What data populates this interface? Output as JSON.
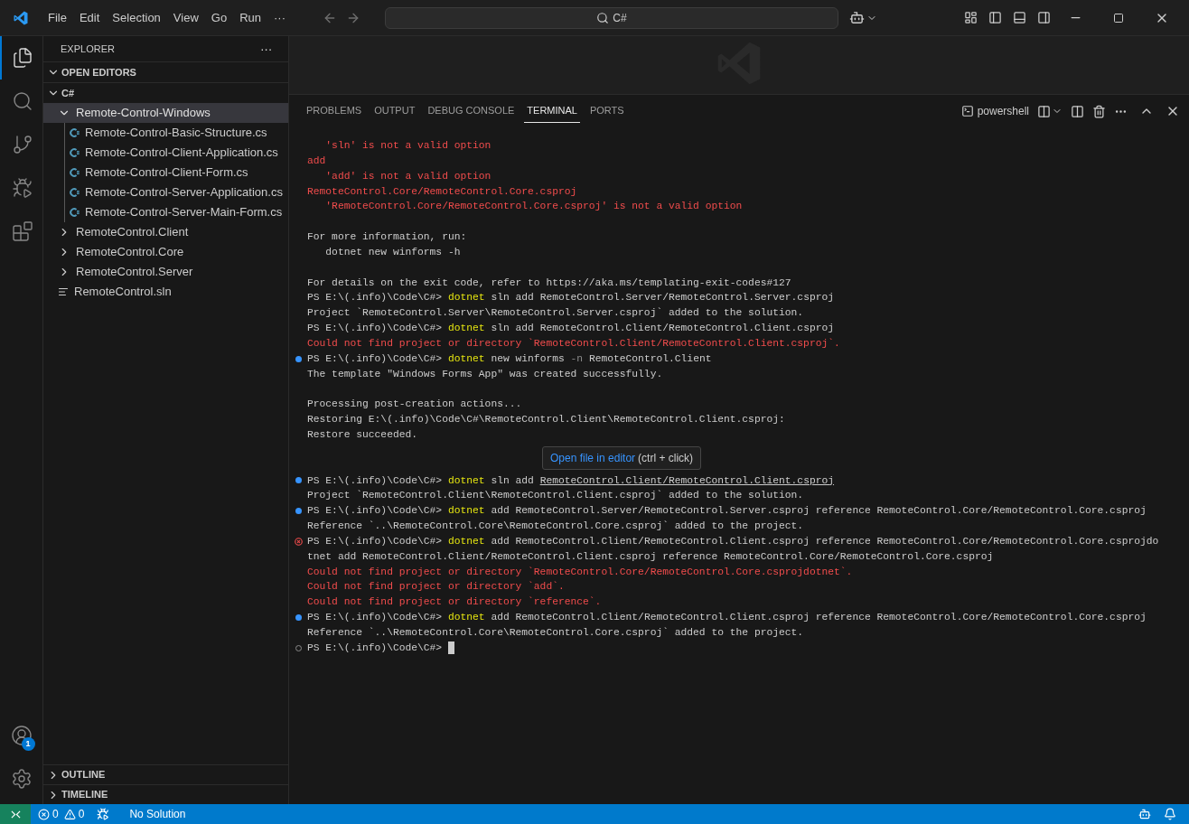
{
  "title_bar": {
    "menu": [
      "File",
      "Edit",
      "Selection",
      "View",
      "Go",
      "Run",
      "···"
    ],
    "search": "C#"
  },
  "activity_bar": {
    "items": [
      {
        "kind": "explorer",
        "selected": true
      },
      {
        "kind": "search",
        "selected": false
      },
      {
        "kind": "source_control",
        "selected": false
      },
      {
        "kind": "run_debug",
        "selected": false
      },
      {
        "kind": "extensions",
        "selected": false
      }
    ],
    "account_badge": "1"
  },
  "sidebar": {
    "title": "EXPLORER",
    "more": "···",
    "sections": [
      {
        "label": "OPEN EDITORS",
        "expanded": true
      },
      {
        "label": "C#",
        "expanded": true,
        "tree": [
          {
            "label": "Remote-Control-Windows",
            "kind": "folder",
            "expanded": true,
            "selected": true,
            "children": [
              {
                "label": "Remote-Control-Basic-Structure.cs",
                "kind": "csharp",
                "selected": false
              },
              {
                "label": "Remote-Control-Client-Application.cs",
                "kind": "csharp",
                "selected": false
              },
              {
                "label": "Remote-Control-Client-Form.cs",
                "kind": "csharp",
                "selected": false
              },
              {
                "label": "Remote-Control-Server-Application.cs",
                "kind": "csharp",
                "selected": false
              },
              {
                "label": "Remote-Control-Server-Main-Form.cs",
                "kind": "csharp",
                "selected": false
              }
            ]
          },
          {
            "label": "RemoteControl.Client",
            "kind": "folder",
            "expanded": false,
            "selected": false
          },
          {
            "label": "RemoteControl.Core",
            "kind": "folder",
            "expanded": false,
            "selected": false
          },
          {
            "label": "RemoteControl.Server",
            "kind": "folder",
            "expanded": false,
            "selected": false
          },
          {
            "label": "RemoteControl.sln",
            "kind": "solution",
            "selected": false
          }
        ]
      }
    ],
    "bottom_sections": [
      {
        "label": "OUTLINE",
        "expanded": false
      },
      {
        "label": "TIMELINE",
        "expanded": false
      }
    ]
  },
  "panel": {
    "tabs": [
      {
        "label": "PROBLEMS",
        "selected": false
      },
      {
        "label": "OUTPUT",
        "selected": false
      },
      {
        "label": "DEBUG CONSOLE",
        "selected": false
      },
      {
        "label": "TERMINAL",
        "selected": true
      },
      {
        "label": "PORTS",
        "selected": false
      }
    ],
    "shell": "powershell",
    "terminal": {
      "cursor_visible": true,
      "blocks": [
        {
          "kind": "output",
          "lines": [
            {
              "kind": "plain",
              "segments": [
                {
                  "kind": "error",
                  "text": "   'sln' is not a valid option"
                }
              ]
            },
            {
              "kind": "plain",
              "segments": [
                {
                  "kind": "error",
                  "text": "add"
                }
              ]
            },
            {
              "kind": "plain",
              "segments": [
                {
                  "kind": "error",
                  "text": "   'add' is not a valid option"
                }
              ]
            },
            {
              "kind": "plain",
              "segments": [
                {
                  "kind": "error",
                  "text": "RemoteControl.Core/RemoteControl.Core.csproj"
                }
              ]
            },
            {
              "kind": "plain",
              "segments": [
                {
                  "kind": "error",
                  "text": "   'RemoteControl.Core/RemoteControl.Core.csproj' is not a valid option"
                }
              ]
            }
          ]
        },
        {
          "kind": "output",
          "lines": [
            {
              "kind": "plain",
              "segments": [
                {
                  "kind": "plain",
                  "text": "For more information, run:"
                }
              ]
            },
            {
              "kind": "plain",
              "segments": [
                {
                  "kind": "plain",
                  "text": "   dotnet new winforms -h"
                }
              ]
            }
          ]
        },
        {
          "kind": "output",
          "lines": [
            {
              "kind": "plain",
              "segments": [
                {
                  "kind": "plain",
                  "text": "For details on the exit code, refer to https://aka.ms/templating-exit-codes#127"
                }
              ]
            },
            {
              "kind": "plain",
              "segments": [
                {
                  "kind": "plain",
                  "text": "PS E:\\(.info)\\Code\\C#> "
                },
                {
                  "kind": "command",
                  "text": "dotnet"
                },
                {
                  "kind": "plain",
                  "text": " sln add RemoteControl.Server/RemoteControl.Server.csproj"
                }
              ]
            },
            {
              "kind": "plain",
              "segments": [
                {
                  "kind": "plain",
                  "text": "Project `RemoteControl.Server\\RemoteControl.Server.csproj` added to the solution."
                }
              ]
            },
            {
              "kind": "plain",
              "segments": [
                {
                  "kind": "plain",
                  "text": "PS E:\\(.info)\\Code\\C#> "
                },
                {
                  "kind": "command",
                  "text": "dotnet"
                },
                {
                  "kind": "plain",
                  "text": " sln add RemoteControl.Client/RemoteControl.Client.csproj"
                }
              ]
            },
            {
              "kind": "plain",
              "segments": [
                {
                  "kind": "error",
                  "text": "Could not find project or directory `RemoteControl.Client/RemoteControl.Client.csproj`."
                }
              ]
            },
            {
              "kind": "command_ok",
              "segments": [
                {
                  "kind": "plain",
                  "text": "PS E:\\(.info)\\Code\\C#> "
                },
                {
                  "kind": "command",
                  "text": "dotnet"
                },
                {
                  "kind": "plain",
                  "text": " new winforms "
                },
                {
                  "kind": "flag",
                  "text": "-n"
                },
                {
                  "kind": "plain",
                  "text": " RemoteControl.Client"
                }
              ]
            },
            {
              "kind": "plain",
              "segments": [
                {
                  "kind": "plain",
                  "text": "The template \"Windows Forms App\" was created successfully."
                }
              ]
            }
          ]
        },
        {
          "kind": "output",
          "lines": [
            {
              "kind": "plain",
              "segments": [
                {
                  "kind": "plain",
                  "text": "Processing post-creation actions..."
                }
              ]
            },
            {
              "kind": "plain",
              "segments": [
                {
                  "kind": "plain",
                  "text": "Restoring E:\\(.info)\\Code\\C#\\RemoteControl.Client\\RemoteControl.Client.csproj:"
                }
              ]
            },
            {
              "kind": "plain",
              "segments": [
                {
                  "kind": "plain",
                  "text": "Restore succeeded."
                }
              ]
            }
          ]
        },
        {
          "kind": "tooltip",
          "link": "Open file in editor",
          "hint": "(ctrl + click)"
        },
        {
          "kind": "output",
          "lines": [
            {
              "kind": "command_ok",
              "segments": [
                {
                  "kind": "plain",
                  "text": "PS E:\\(.info)\\Code\\C#> "
                },
                {
                  "kind": "command",
                  "text": "dotnet"
                },
                {
                  "kind": "plain",
                  "text": " sln add "
                },
                {
                  "kind": "link",
                  "text": "RemoteControl.Client/RemoteControl.Client.csproj"
                }
              ]
            },
            {
              "kind": "plain",
              "segments": [
                {
                  "kind": "plain",
                  "text": "Project `RemoteControl.Client\\RemoteControl.Client.csproj` added to the solution."
                }
              ]
            },
            {
              "kind": "command_ok",
              "segments": [
                {
                  "kind": "plain",
                  "text": "PS E:\\(.info)\\Code\\C#> "
                },
                {
                  "kind": "command",
                  "text": "dotnet"
                },
                {
                  "kind": "plain",
                  "text": " add RemoteControl.Server/RemoteControl.Server.csproj reference RemoteControl.Core/RemoteControl.Core.csproj"
                }
              ]
            },
            {
              "kind": "plain",
              "segments": [
                {
                  "kind": "plain",
                  "text": "Reference `..\\RemoteControl.Core\\RemoteControl.Core.csproj` added to the project."
                }
              ]
            },
            {
              "kind": "command_failed",
              "segments": [
                {
                  "kind": "plain",
                  "text": "PS E:\\(.info)\\Code\\C#> "
                },
                {
                  "kind": "command",
                  "text": "dotnet"
                },
                {
                  "kind": "plain",
                  "text": " add RemoteControl.Client/RemoteControl.Client.csproj reference RemoteControl.Core/RemoteControl.Core.csprojdo"
                }
              ]
            },
            {
              "kind": "plain",
              "segments": [
                {
                  "kind": "plain",
                  "text": "tnet add RemoteControl.Client/RemoteControl.Client.csproj reference RemoteControl.Core/RemoteControl.Core.csproj"
                }
              ]
            },
            {
              "kind": "plain",
              "segments": [
                {
                  "kind": "error",
                  "text": "Could not find project or directory `RemoteControl.Core/RemoteControl.Core.csprojdotnet`."
                }
              ]
            },
            {
              "kind": "plain",
              "segments": [
                {
                  "kind": "error",
                  "text": "Could not find project or directory `add`."
                }
              ]
            },
            {
              "kind": "plain",
              "segments": [
                {
                  "kind": "error",
                  "text": "Could not find project or directory `reference`."
                }
              ]
            },
            {
              "kind": "command_ok",
              "segments": [
                {
                  "kind": "plain",
                  "text": "PS E:\\(.info)\\Code\\C#> "
                },
                {
                  "kind": "command",
                  "text": "dotnet"
                },
                {
                  "kind": "plain",
                  "text": " add RemoteControl.Client/RemoteControl.Client.csproj reference RemoteControl.Core/RemoteControl.Core.csproj"
                }
              ]
            },
            {
              "kind": "plain",
              "segments": [
                {
                  "kind": "plain",
                  "text": "Reference `..\\RemoteControl.Core\\RemoteControl.Core.csproj` added to the project."
                }
              ]
            },
            {
              "kind": "prompt",
              "segments": [
                {
                  "kind": "plain",
                  "text": "PS E:\\(.info)\\Code\\C#> "
                }
              ]
            }
          ]
        }
      ]
    }
  },
  "status_bar": {
    "errors": "0",
    "warnings": "0",
    "solution": "No Solution"
  }
}
